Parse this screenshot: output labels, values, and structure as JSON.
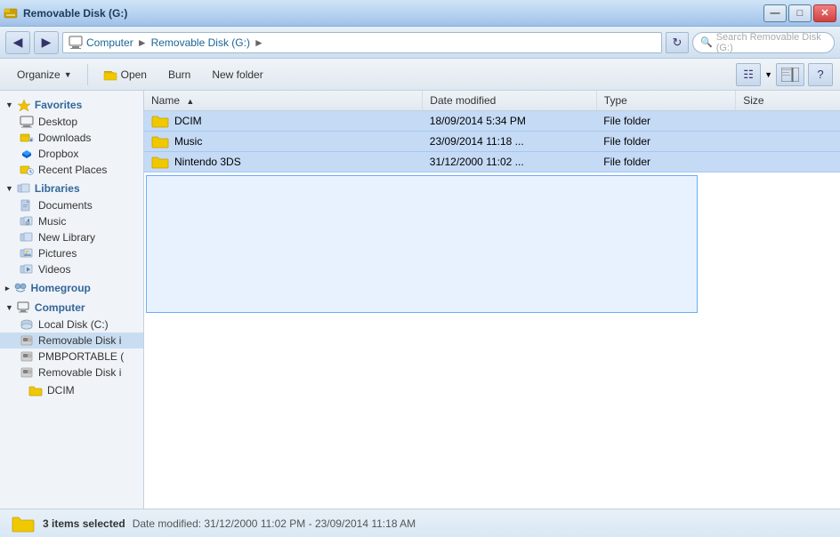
{
  "titleBar": {
    "title": "Removable Disk (G:)",
    "controls": {
      "minimize": "—",
      "maximize": "□",
      "close": "✕"
    }
  },
  "addressBar": {
    "back": "◄",
    "forward": "►",
    "up": "↑",
    "path": [
      "Computer",
      "Removable Disk (G:)"
    ],
    "refresh": "↻",
    "searchPlaceholder": "Search Removable Disk (G:)",
    "searchIcon": "🔍"
  },
  "toolbar": {
    "organize": "Organize",
    "open": "Open",
    "burn": "Burn",
    "newFolder": "New folder",
    "viewIcon": "☰",
    "helpIcon": "?"
  },
  "sidebar": {
    "favorites": {
      "label": "Favorites",
      "items": [
        {
          "name": "Desktop",
          "icon": "desktop"
        },
        {
          "name": "Downloads",
          "icon": "downloads"
        },
        {
          "name": "Dropbox",
          "icon": "dropbox"
        },
        {
          "name": "Recent Places",
          "icon": "recent"
        }
      ]
    },
    "libraries": {
      "label": "Libraries",
      "items": [
        {
          "name": "Documents",
          "icon": "documents"
        },
        {
          "name": "Music",
          "icon": "music"
        },
        {
          "name": "New Library",
          "icon": "library"
        },
        {
          "name": "Pictures",
          "icon": "pictures"
        },
        {
          "name": "Videos",
          "icon": "videos"
        }
      ]
    },
    "homegroup": {
      "label": "Homegroup"
    },
    "computer": {
      "label": "Computer",
      "items": [
        {
          "name": "Local Disk (C:)",
          "icon": "disk"
        },
        {
          "name": "Removable Disk i",
          "icon": "removable",
          "selected": true
        },
        {
          "name": "PMBPORTABLE (",
          "icon": "removable"
        },
        {
          "name": "Removable Disk i",
          "icon": "removable"
        }
      ]
    },
    "dcim": {
      "label": "DCIM"
    }
  },
  "fileList": {
    "columns": [
      "Name",
      "Date modified",
      "Type",
      "Size"
    ],
    "rows": [
      {
        "name": "DCIM",
        "dateModified": "18/09/2014 5:34 PM",
        "type": "File folder",
        "size": "",
        "selected": true
      },
      {
        "name": "Music",
        "dateModified": "23/09/2014 11:18 ...",
        "type": "File folder",
        "size": "",
        "selected": true
      },
      {
        "name": "Nintendo 3DS",
        "dateModified": "31/12/2000 11:02 ...",
        "type": "File folder",
        "size": "",
        "selected": true
      }
    ]
  },
  "statusBar": {
    "itemsSelected": "3 items selected",
    "dateRange": "Date modified: 31/12/2000 11:02 PM - 23/09/2014 11:18 AM"
  }
}
